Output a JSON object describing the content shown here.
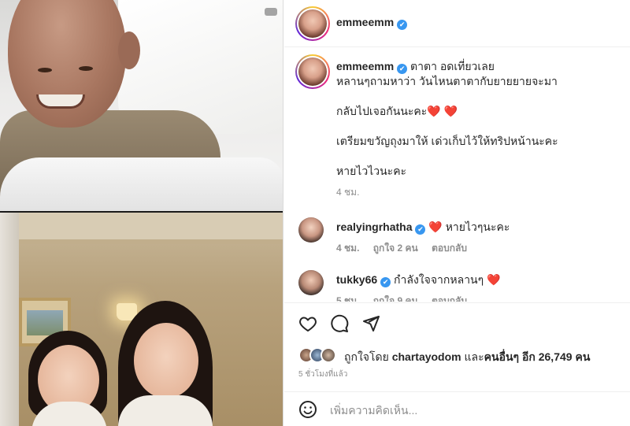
{
  "post": {
    "author": "emmeemm",
    "verified_mark": "✔"
  },
  "caption": {
    "author": "emmeemm",
    "line1": "ตาตา อดเที่ยวเลย",
    "line2": "หลานๆถามหาว่า วันไหนตาตากับยายยายจะมา",
    "line3": "กลับไปเจอกันนะคะ❤️ ❤️",
    "line4": "เตรียมขวัญถุงมาให้ เด่วเก็บไว้ให้ทริปหน้านะคะ",
    "line5": "หายไวไวนะคะ",
    "time": "4 ชม."
  },
  "comments": [
    {
      "username": "realyingrhatha",
      "text": "❤️ หายไวๆนะคะ",
      "time": "4 ชม.",
      "likes": "ถูกใจ 2 คน",
      "reply": "ตอบกลับ"
    },
    {
      "username": "tukky66",
      "text": "กำลังใจจากหลานๆ ❤️",
      "time": "5 ชม.",
      "likes": "ถูกใจ 9 คน",
      "reply": "ตอบกลับ"
    }
  ],
  "actions": {
    "like_icon": "heart-outline-icon",
    "comment_icon": "comment-bubble-icon",
    "share_icon": "paper-plane-icon"
  },
  "likes": {
    "prefix": "ถูกใจโดย",
    "user": "chartayodom",
    "and": "และ",
    "others_label": "คนอื่นๆ อีก 26,749 คน"
  },
  "posted": "5 ชั่วโมงที่แล้ว",
  "add_comment": {
    "placeholder": "เพิ่มความคิดเห็น...",
    "emoji_icon": "smiley-icon"
  },
  "colors": {
    "verified": "#3897f0",
    "heart": "#ed1c24",
    "muted": "#8e8e8e",
    "text": "#262626"
  }
}
